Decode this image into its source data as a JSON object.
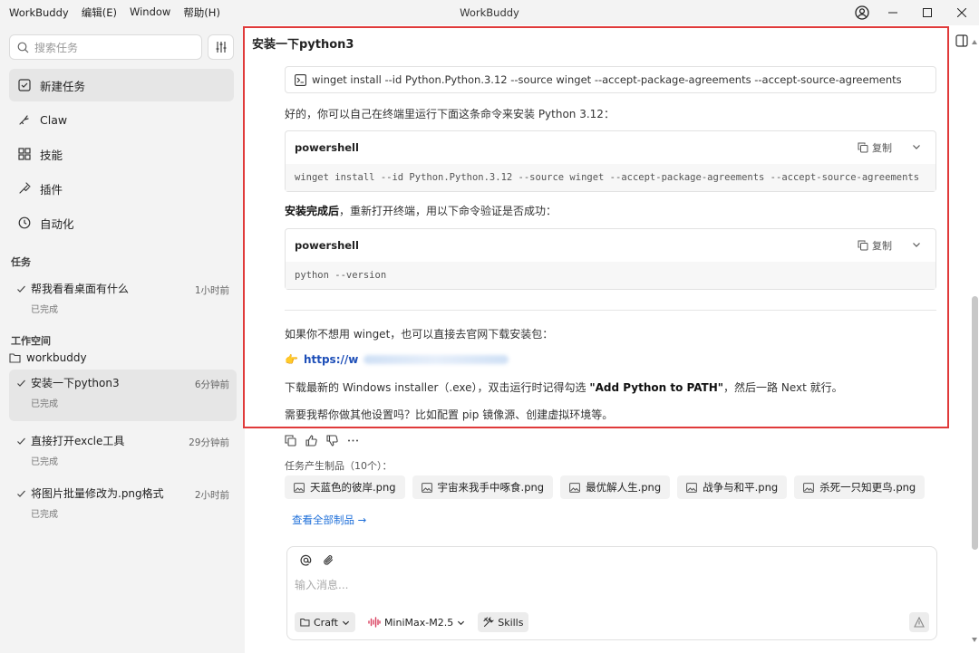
{
  "window": {
    "app_name": "WorkBuddy",
    "title": "WorkBuddy",
    "menus": [
      "编辑(E)",
      "Window",
      "帮助(H)"
    ]
  },
  "sidebar": {
    "search_placeholder": "搜索任务",
    "nav": [
      {
        "label": "新建任务",
        "icon": "new-task-icon"
      },
      {
        "label": "Claw",
        "icon": "claw-icon"
      },
      {
        "label": "技能",
        "icon": "skills-icon"
      },
      {
        "label": "插件",
        "icon": "plugin-icon"
      },
      {
        "label": "自动化",
        "icon": "clock-icon"
      }
    ],
    "tasks_label": "任务",
    "tasks": [
      {
        "name": "帮我看看桌面有什么",
        "time": "1小时前",
        "status": "已完成"
      }
    ],
    "workspace_label": "工作空间",
    "workspace": {
      "name": "workbuddy",
      "tasks": [
        {
          "name": "安装一下python3",
          "time": "6分钟前",
          "status": "已完成"
        },
        {
          "name": "直接打开excle工具",
          "time": "29分钟前",
          "status": "已完成"
        },
        {
          "name": "将图片批量修改为.png格式",
          "time": "2小时前",
          "status": "已完成"
        }
      ]
    }
  },
  "chat": {
    "title": "安装一下python3",
    "command_line": "winget install --id Python.Python.3.12 --source winget --accept-package-agreements --accept-source-agreements",
    "para1": "好的，你可以自己在终端里运行下面这条命令来安装 Python 3.12：",
    "code1": {
      "lang": "powershell",
      "copy_label": "复制",
      "code": "winget install --id Python.Python.3.12 --source winget --accept-package-agreements --accept-source-agreements"
    },
    "para2_bold": "安装完成后",
    "para2_rest": "，重新打开终端，用以下命令验证是否成功：",
    "code2": {
      "lang": "powershell",
      "copy_label": "复制",
      "code": "python --version"
    },
    "para3": "如果你不想用 winget，也可以直接去官网下载安装包：",
    "link_emoji": "👉",
    "link_text": "https://w",
    "para4_pre": "下载最新的 Windows installer（.exe），双击运行时记得勾选 ",
    "para4_bold": "\"Add Python to PATH\"",
    "para4_post": "，然后一路 Next 就行。",
    "para5": "需要我帮你做其他设置吗？比如配置 pip 镜像源、创建虚拟环境等。"
  },
  "artifacts": {
    "label": "任务产生制品（10个）：",
    "items": [
      "天蓝色的彼岸.png",
      "宇宙来我手中啄食.png",
      "最优解人生.png",
      "战争与和平.png",
      "杀死一只知更鸟.png"
    ],
    "view_all": "查看全部制品 →"
  },
  "composer": {
    "placeholder": "输入消息...",
    "mode_label": "Craft",
    "model_label": "MiniMax-M2.5",
    "skills_label": "Skills"
  },
  "colors": {
    "highlight": "#e03a3a",
    "link": "#1e4fb8",
    "sidebar_bg": "#f3f3f3"
  }
}
